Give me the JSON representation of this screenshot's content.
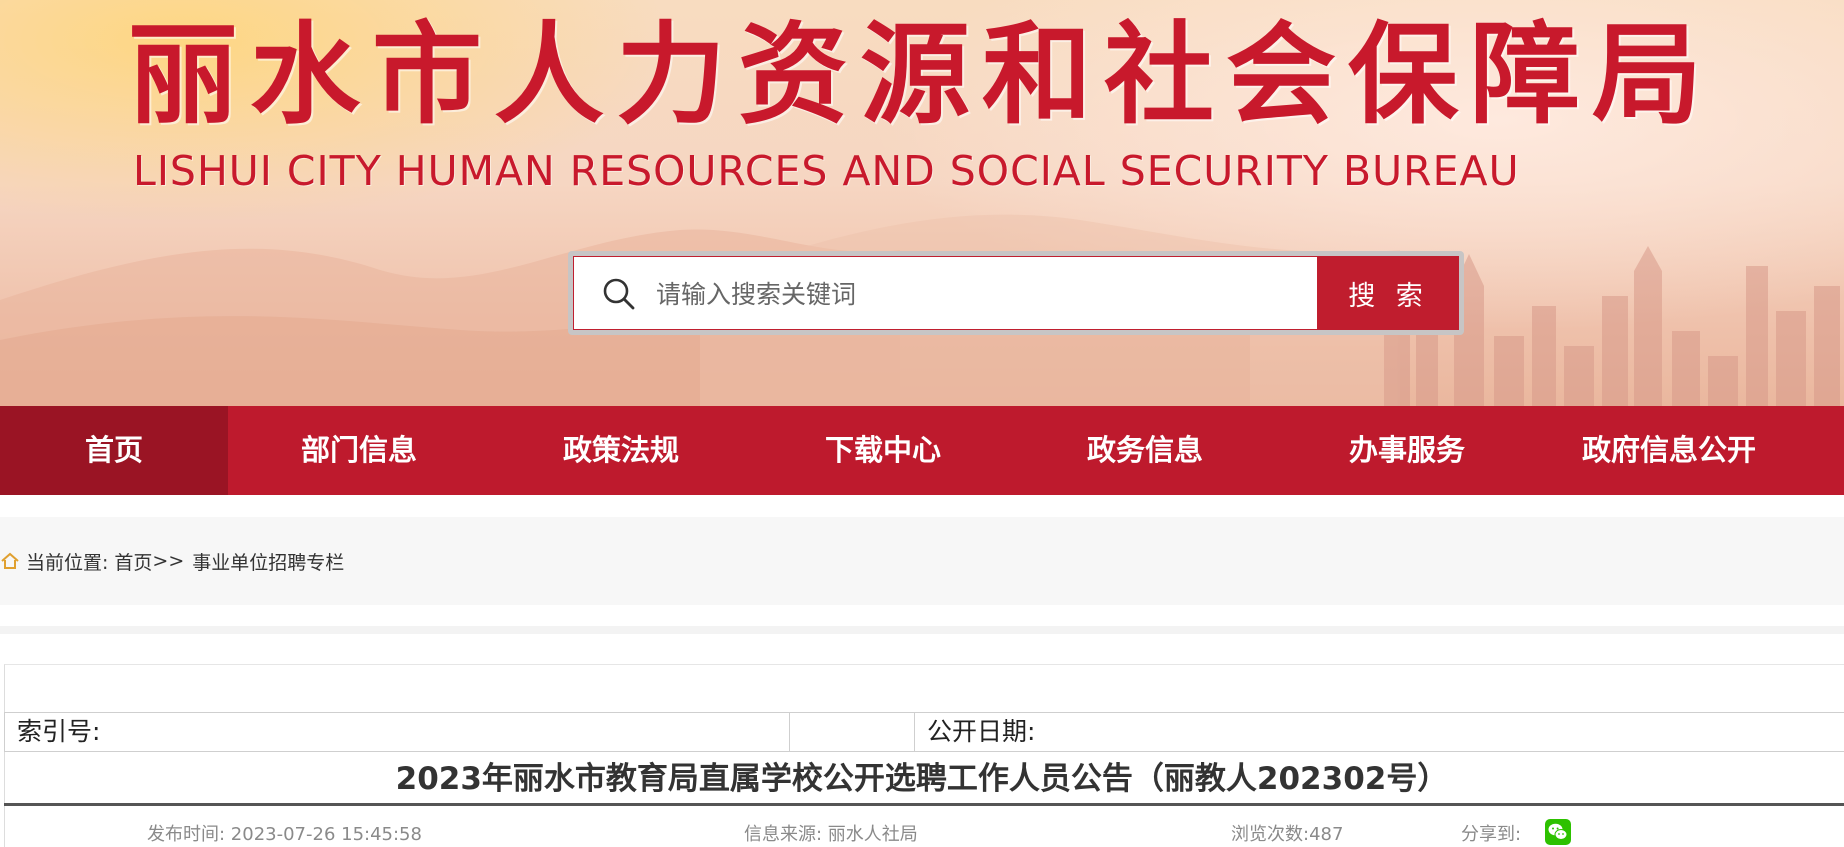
{
  "header": {
    "title_cn": "丽水市人力资源和社会保障局",
    "title_en": "LISHUI CITY HUMAN RESOURCES AND SOCIAL SECURITY BUREAU"
  },
  "search": {
    "placeholder": "请输入搜索关键词",
    "button_label": "搜 索"
  },
  "nav": {
    "items": [
      {
        "label": "首页",
        "active": true
      },
      {
        "label": "部门信息"
      },
      {
        "label": "政策法规"
      },
      {
        "label": "下载中心"
      },
      {
        "label": "政务信息"
      },
      {
        "label": "办事服务"
      },
      {
        "label": "政府信息公开"
      }
    ]
  },
  "breadcrumb": {
    "prefix": "当前位置:",
    "home": "首页",
    "separator": ">>",
    "current": "事业单位招聘专栏"
  },
  "meta": {
    "index_label": "索引号:",
    "index_value": "",
    "date_label": "公开日期:",
    "date_value": ""
  },
  "article": {
    "title": "2023年丽水市教育局直属学校公开选聘工作人员公告（丽教人202302号）",
    "publish_time": "发布时间: 2023-07-26 15:45:58",
    "source": "信息来源: 丽水人社局",
    "views": "浏览次数:487",
    "share_label": "分享到:"
  },
  "colors": {
    "brand_red": "#be1a2d",
    "active_nav": "#9a1424",
    "wechat_green": "#2dc100"
  }
}
